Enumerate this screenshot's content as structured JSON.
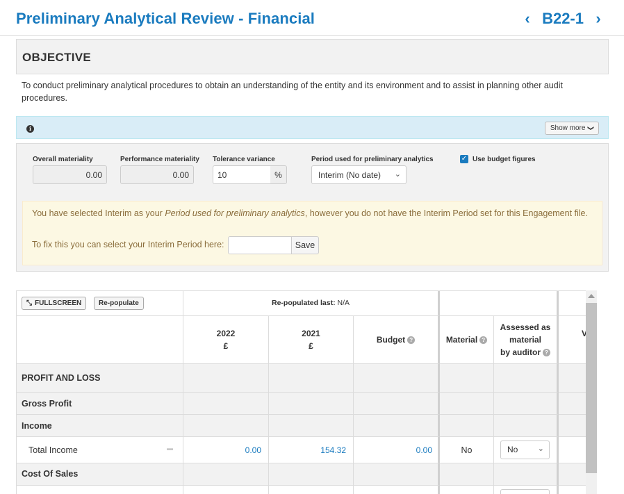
{
  "header": {
    "title": "Preliminary Analytical Review - Financial",
    "code": "B22-1",
    "prev_icon": "chevron-left-icon",
    "next_icon": "chevron-right-icon",
    "prev_glyph": "‹",
    "next_glyph": "›"
  },
  "objective": {
    "heading": "OBJECTIVE",
    "text": "To conduct preliminary analytical procedures to obtain an understanding of the entity and its environment and to assist in planning other audit procedures."
  },
  "info_bar": {
    "icon": "info-icon",
    "icon_glyph": "i",
    "show_more_label": "Show more",
    "caret_glyph": "❯"
  },
  "settings": {
    "overall_materiality": {
      "label": "Overall materiality",
      "value": "0.00"
    },
    "performance_materiality": {
      "label": "Performance materiality",
      "value": "0.00"
    },
    "tolerance_variance": {
      "label": "Tolerance variance",
      "value": "10",
      "unit": "%"
    },
    "period": {
      "label": "Period used for preliminary analytics",
      "selected": "Interim (No date)",
      "arrow_glyph": "⌄"
    },
    "use_budget": {
      "label": "Use budget figures",
      "checked": true,
      "check_glyph": "✓"
    }
  },
  "warning": {
    "msg_prefix": "You have selected Interim as your ",
    "msg_italic": "Period used for preliminary analytics",
    "msg_suffix": ", however you do not have the Interim Period set for this Engagement file.",
    "fix_text": "To fix this you can select your Interim Period here:",
    "input_value": "",
    "save_label": "Save"
  },
  "table": {
    "fullscreen_label": "FULLSCREEN",
    "fullscreen_icon": "expand-icon",
    "fullscreen_glyph": "⤡",
    "repopulate_label": "Re-populate",
    "repopulated_label": "Re-populated last:",
    "repopulated_value": "N/A",
    "columns": {
      "y2022": {
        "line1": "2022",
        "line2": "£"
      },
      "y2021": {
        "line1": "2021",
        "line2": "£"
      },
      "budget": "Budget",
      "material": "Material",
      "assessed": {
        "line1": "Assessed as",
        "line2": "material",
        "line3": "by auditor"
      },
      "next_partial": "V",
      "help_glyph": "?"
    },
    "sections": {
      "profit_and_loss": "PROFIT AND LOSS",
      "gross_profit": "Gross Profit",
      "income": "Income",
      "cost_of_sales": "Cost Of Sales"
    },
    "rows": [
      {
        "label": "Total Income",
        "comment_icon": "comment-icon",
        "comment_glyph": "▬",
        "v2022": "0.00",
        "v2021": "154.32",
        "budget": "0.00",
        "material": "No",
        "assessed": "No",
        "arrow_glyph": "⌄"
      }
    ]
  }
}
